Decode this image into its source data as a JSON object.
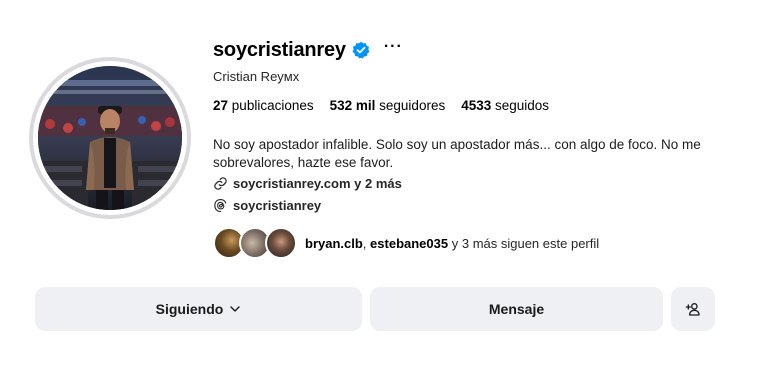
{
  "profile": {
    "username": "soycristianrey",
    "full_name": "Cristian Reyмx",
    "verified": true
  },
  "stats": {
    "posts_count": "27",
    "posts_label": "publicaciones",
    "followers_count": "532 mil",
    "followers_label": "seguidores",
    "following_count": "4533",
    "following_label": "seguidos"
  },
  "bio": {
    "text": "No soy apostador infalible. Solo soy un apostador más... con algo de foco. No me sobrevalores, hazte ese favor.",
    "link_text": "soycristianrey.com y 2 más",
    "threads_text": "soycristianrey"
  },
  "followed_by": {
    "user1": "bryan.clb",
    "separator": ",",
    "user2": "estebane035",
    "rest": "y 3 más siguen este perfil"
  },
  "actions": {
    "following_label": "Siguiendo",
    "message_label": "Mensaje"
  },
  "colors": {
    "verified_badge": "#0095f6",
    "button_bg": "#eff0f4"
  },
  "icons": {
    "verified": "verified-badge-icon",
    "more": "more-options-icon",
    "link": "link-icon",
    "threads": "threads-icon",
    "chevron": "chevron-down-icon",
    "add_person": "add-person-icon"
  }
}
